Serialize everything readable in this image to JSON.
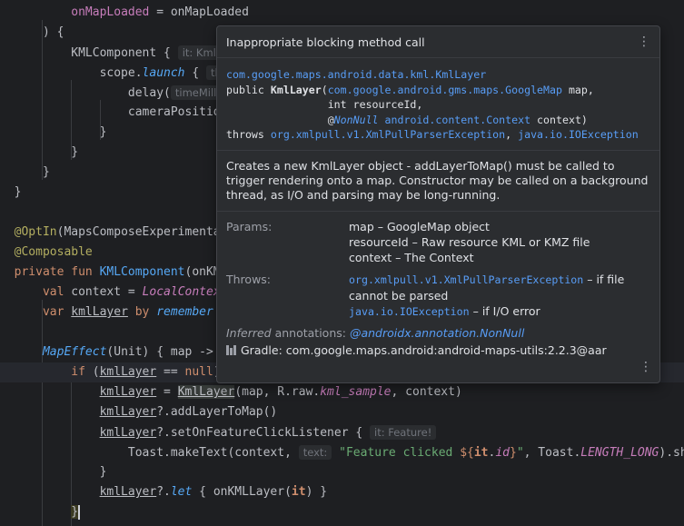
{
  "code": {
    "l1_a": "onMapLoaded",
    "l1_b": " = onMapLoaded",
    "l2": ") {",
    "l3_fn": "KMLComponent",
    "l3_b": " { ",
    "l3_hint": "it: Kml",
    "l4_a": "scope.",
    "l4_fn": "launch",
    "l4_b": " { ",
    "l4_hint": "th",
    "l5_a": "delay(",
    "l5_hint": "timeMilli",
    "l6_a": "cameraPositio",
    "l7": "}",
    "l8": "}",
    "l9": "}",
    "l10": "}",
    "l12_ann": "@OptIn",
    "l12_b": "(MapsComposeExperimenta",
    "l13_ann": "@Composable",
    "l14_kw": "private fun ",
    "l14_fn": "KMLComponent",
    "l14_b": "(onKM",
    "l15_kw": "val ",
    "l15_b": "context = ",
    "l15_prop": "LocalContex",
    "l16_kw": "var ",
    "l16_var": "kmlLayer",
    "l16_by": " by ",
    "l16_rem": "remember",
    "l18_fn": "MapEffect",
    "l18_b": "(Unit) { map ->",
    "l19_kw": "if ",
    "l19_b": "(",
    "l19_var": "kmlLayer",
    "l19_c": " == ",
    "l19_null": "null",
    "l19_d": ")",
    "l20_var": "kmlLayer",
    "l20_b": " = ",
    "l20_cls": "KmlLayer",
    "l20_c": "(map, R.raw.",
    "l20_res": "kml_sample",
    "l20_d": ", context)",
    "l21_var": "kmlLayer",
    "l21_b": "?.addLayerToMap()",
    "l22_var": "kmlLayer",
    "l22_b": "?.setOnFeatureClickListener { ",
    "l22_hint": "it: Feature!",
    "l23_a": "Toast.makeText(context, ",
    "l23_hint": "text:",
    "l23_str": " \"Feature clicked ",
    "l23_tmpl_open": "${",
    "l23_it": "it",
    "l23_dot": ".",
    "l23_id": "id",
    "l23_tmpl_close": "}",
    "l23_str_end": "\"",
    "l23_b": ", Toast.",
    "l23_const": "LENGTH_LONG",
    "l23_c": ").sho",
    "l24": "}",
    "l25_var": "kmlLayer",
    "l25_b": "?.",
    "l25_let": "let",
    "l25_c": " { onKMLLayer(",
    "l25_it": "it",
    "l25_d": ") }",
    "l26": "}"
  },
  "popup": {
    "title": "Inappropriate blocking method call",
    "sig": {
      "fqcn": "com.google.maps.android.data.kml.KmlLayer",
      "public": "public ",
      "name": "KmlLayer",
      "open": "(",
      "p1_type": "com.google.android.gms.maps.GoogleMap",
      "p1_name": " map,",
      "p2": "int resourceId,",
      "p3_at": "@",
      "p3_ann": "NonNull",
      "p3_type": "android.content.Context",
      "p3_name": " context)",
      "throws": "throws ",
      "ex1": "org.xmlpull.v1.XmlPullParserException",
      "comma": ", ",
      "ex2": "java.io.IOException"
    },
    "description": "Creates a new KmlLayer object - addLayerToMap() must be called to trigger rendering onto a map. Constructor may be called on a background thread, as I/O and parsing may be long-running.",
    "params_label": "Params:",
    "params": [
      "map – GoogleMap object",
      "resourceId – Raw resource KML or KMZ file",
      "context – The Context"
    ],
    "throws_label": "Throws:",
    "throws1_link": "org.xmlpull.v1.XmlPullParserException",
    "throws1_text": " – if file cannot be parsed",
    "throws2_link": "java.io.IOException",
    "throws2_text": " – if I/O error",
    "inferred_label": "Inferred",
    "inferred_rest": " annotations: ",
    "inferred_link": "@androidx.annotation.NonNull",
    "gradle": "Gradle: com.google.maps.android:android-maps-utils:2.2.3@aar"
  },
  "icons": {
    "more": "more-vertical-icon",
    "library": "library-icon"
  }
}
